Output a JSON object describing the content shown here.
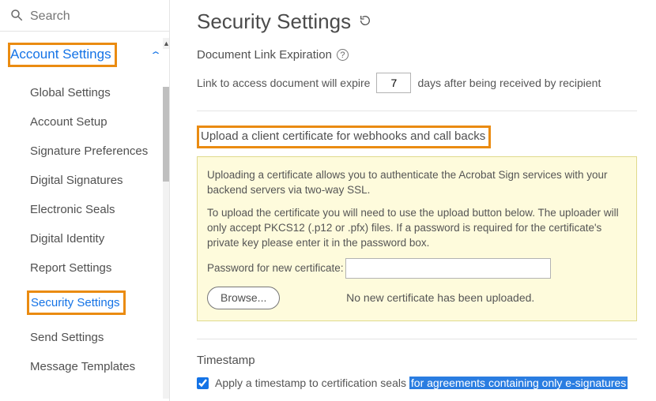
{
  "search": {
    "placeholder": "Search"
  },
  "sidebar": {
    "section_label": "Account Settings",
    "items": [
      {
        "label": "Global Settings"
      },
      {
        "label": "Account Setup"
      },
      {
        "label": "Signature Preferences"
      },
      {
        "label": "Digital Signatures"
      },
      {
        "label": "Electronic Seals"
      },
      {
        "label": "Digital Identity"
      },
      {
        "label": "Report Settings"
      },
      {
        "label": "Security Settings"
      },
      {
        "label": "Send Settings"
      },
      {
        "label": "Message Templates"
      }
    ]
  },
  "page": {
    "title": "Security Settings",
    "expire": {
      "heading": "Document Link Expiration",
      "before": "Link to access document will expire",
      "value": "7",
      "after": "days after being received by recipient"
    },
    "upload": {
      "heading": "Upload a client certificate for webhooks and call backs",
      "p1": "Uploading a certificate allows you to authenticate the Acrobat Sign services with your backend servers via two-way SSL.",
      "p2": "To upload the certificate you will need to use the upload button below. The uploader will only accept PKCS12 (.p12 or .pfx) files. If a password is required for the certificate's private key please enter it in the password box.",
      "pw_label": "Password for new certificate:",
      "browse": "Browse...",
      "status": "No new certificate has been uploaded."
    },
    "timestamp": {
      "heading": "Timestamp",
      "chk_label_a": "Apply a timestamp to certification seals ",
      "chk_label_b": "for agreements containing only e-signatures",
      "checked": true
    }
  }
}
